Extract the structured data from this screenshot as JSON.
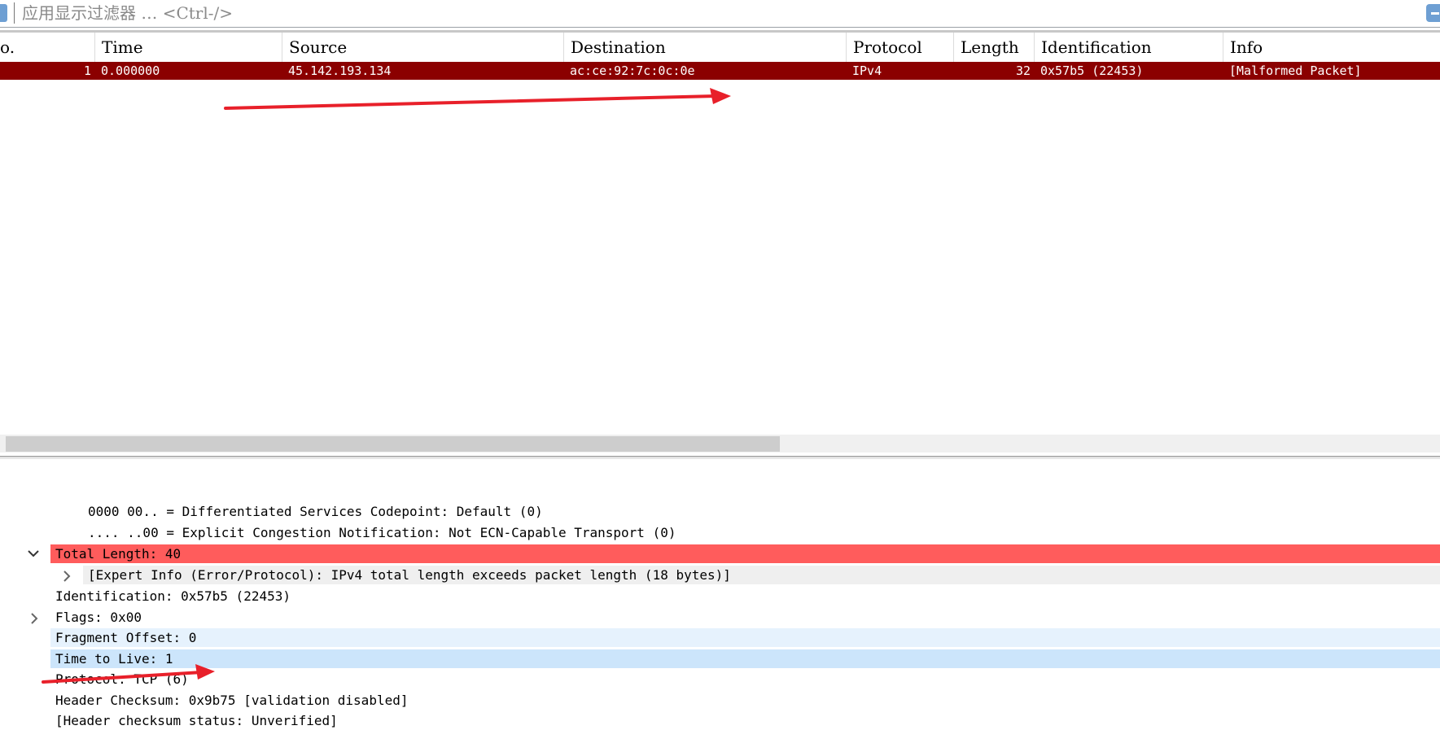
{
  "filter": {
    "placeholder": "应用显示过滤器 … <Ctrl-/>"
  },
  "columns": [
    "o.",
    "Time",
    "Source",
    "Destination",
    "Protocol",
    "Length",
    "Identification",
    "Info"
  ],
  "packets": [
    {
      "no": "1",
      "time": "0.000000",
      "source": "45.142.193.134",
      "destination": "ac:ce:92:7c:0c:0e",
      "protocol": "IPv4",
      "length": "32",
      "identification": "0x57b5 (22453)",
      "info": "[Malformed Packet]"
    }
  ],
  "details": [
    "0000 00.. = Differentiated Services Codepoint: Default (0)",
    ".... ..00 = Explicit Congestion Notification: Not ECN-Capable Transport (0)",
    "Total Length: 40",
    "[Expert Info (Error/Protocol): IPv4 total length exceeds packet length (18 bytes)]",
    "Identification: 0x57b5 (22453)",
    "Flags: 0x00",
    "Fragment Offset: 0",
    "Time to Live: 1",
    "Protocol: TCP (6)",
    "Header Checksum: 0x9b75 [validation disabled]",
    "[Header checksum status: Unverified]"
  ],
  "colors": {
    "selected_row": "#8b0000",
    "error_row": "#ff5c5c",
    "expert_row": "#efefef",
    "highlight_light": "#e6f2fd",
    "highlight": "#cce5fb",
    "annotation_arrow": "#e8202a"
  }
}
